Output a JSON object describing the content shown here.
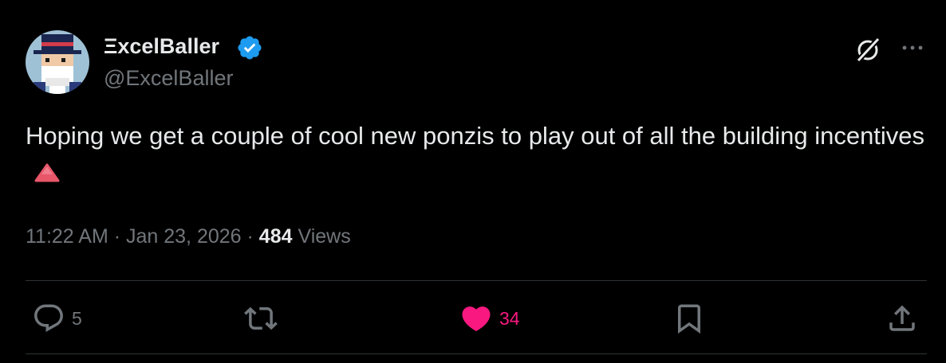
{
  "author": {
    "display_name": "ΞxcelBaller",
    "handle": "@ExcelBaller",
    "verified": true,
    "avatar_icon": "pixel-art-wizard-avatar"
  },
  "header_icons": {
    "grok": "grok-icon",
    "more": "more-options-icon"
  },
  "tweet": {
    "text": "Hoping we get a couple of cool new ponzis to play out of all the building incentives",
    "emoji": "red-triangle-icon"
  },
  "meta": {
    "time": "11:22 AM",
    "separator": " · ",
    "date": "Jan 23, 2026",
    "views_count": "484",
    "views_label": "Views"
  },
  "actions": {
    "replies": "5",
    "reposts": "",
    "likes": "34",
    "bookmarks": "",
    "share": ""
  },
  "colors": {
    "background": "#000000",
    "text": "#e7e9ea",
    "secondary": "#71767b",
    "like": "#f91880",
    "verified": "#1d9bf0",
    "divider": "#2f3336"
  }
}
